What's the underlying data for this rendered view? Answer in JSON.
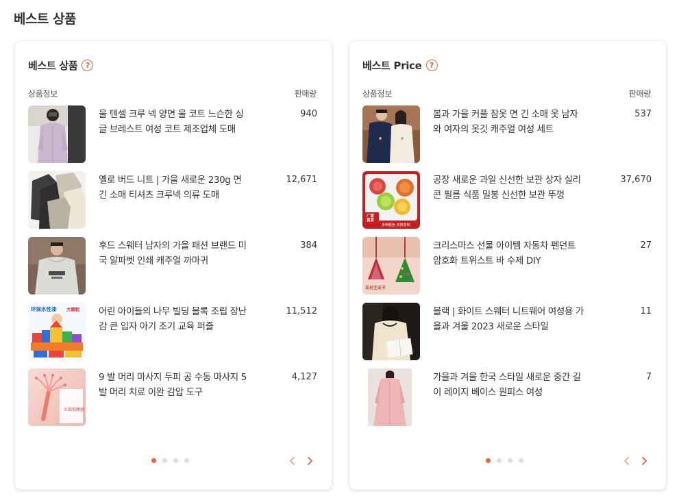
{
  "page": {
    "title": "베스트 상품"
  },
  "colors": {
    "accent": "#e8623a",
    "dot_inactive": "#dcdcdc"
  },
  "left_card": {
    "title": "베스트 상품",
    "help_icon": "question-circle-icon",
    "col_info": "상품정보",
    "col_sales": "판매량",
    "products": [
      {
        "name": "울 텐셀 크루 넥 양면 울 코트 느슨한 싱글 브레스트 여성 코트 제조업체 도매",
        "sales": "940"
      },
      {
        "name": "옐로 버드 니트 | 가을 새로운 230g 면 긴 소매 티셔츠 크루넥 의류 도매",
        "sales": "12,671"
      },
      {
        "name": "후드 스웨터 남자의 가을 패션 브랜드 미국 알파벳 인쇄 캐주얼 까마귀",
        "sales": "384"
      },
      {
        "name": "어린 아이들의 나무 빌딩 블록 조립 장난감 큰 입자 아기 조기 교육 퍼즐",
        "sales": "11,512"
      },
      {
        "name": "9 발 머리 마사지 두피 공 수동 마사지 5 발 머리 치료 이완 감압 도구",
        "sales": "4,127"
      }
    ],
    "pagination": {
      "pages": 4,
      "current": 1
    }
  },
  "right_card": {
    "title": "베스트 Price",
    "help_icon": "question-circle-icon",
    "col_info": "상품정보",
    "col_sales": "판매량",
    "products": [
      {
        "name": "봄과 가을 커플 잠옷 면 긴 소매 옷 남자와 여자의 옷깃 캐주얼 여성 세트",
        "sales": "537"
      },
      {
        "name": "공장 새로운 과일 신선한 보관 상자 실리콘 필름 식품 밀봉 신선한 보관 뚜껑",
        "sales": "37,670"
      },
      {
        "name": "크리스마스 선물 아이템 자동차 펜던트 암호화 트위스트 바 수제 DIY",
        "sales": "27"
      },
      {
        "name": "블랙 | 화이트 스웨터 니트웨어 여성용 가을과 겨울 2023 새로운 스타일",
        "sales": "11"
      },
      {
        "name": "가을과 겨울 한국 스타일 새로운 중간 길이 레이지 베이스 원피스 여성",
        "sales": "7"
      }
    ],
    "pagination": {
      "pages": 4,
      "current": 1
    }
  },
  "thumb_images": {
    "l0": {
      "title": "product-thumb-wool-coat"
    },
    "l1": {
      "title": "product-thumb-knit-tshirts"
    },
    "l2": {
      "title": "product-thumb-hoodie"
    },
    "l3": {
      "title": "product-thumb-wooden-blocks",
      "text1": "环保水性漆",
      "text2": "大颗粒"
    },
    "l4": {
      "title": "product-thumb-head-massager",
      "text": "头部按摩器"
    },
    "r0": {
      "title": "product-thumb-couple-pajamas"
    },
    "r1": {
      "title": "product-thumb-silicone-lids",
      "text1": "厂家",
      "text2": "直发",
      "text3": "多种颜色 支持定制"
    },
    "r2": {
      "title": "product-thumb-christmas-pendant",
      "text": "装扮圣诞节"
    },
    "r3": {
      "title": "product-thumb-sweater"
    },
    "r4": {
      "title": "product-thumb-pink-dress"
    }
  }
}
